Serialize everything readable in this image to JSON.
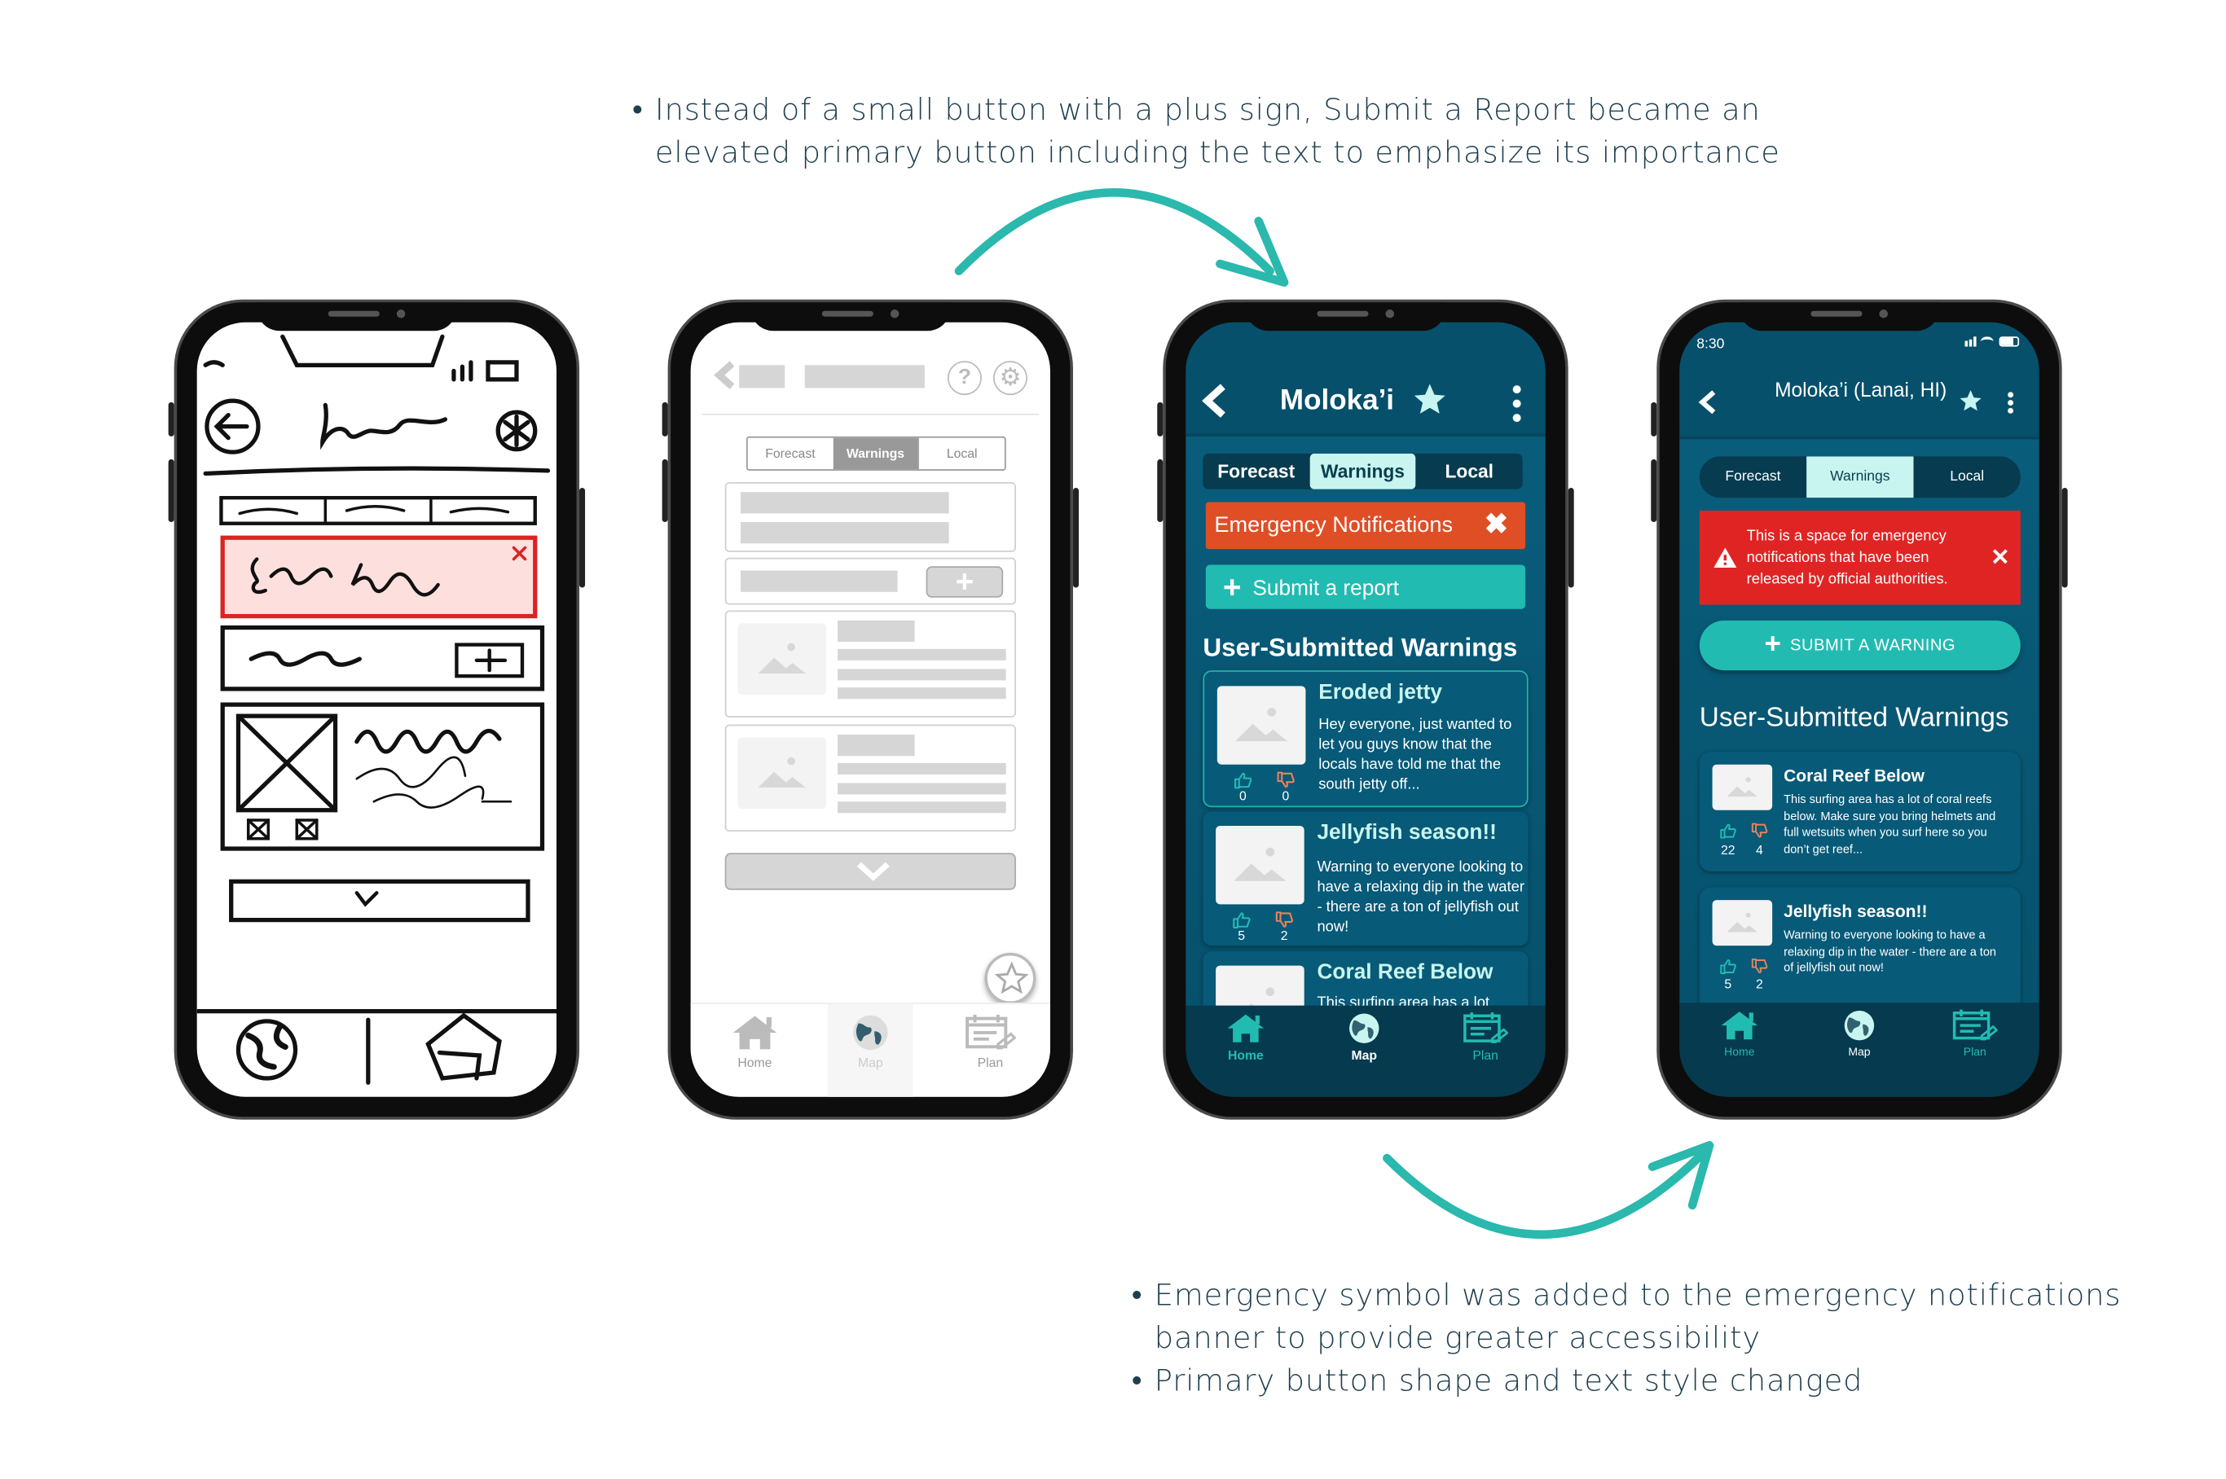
{
  "annotations": {
    "top": [
      "Instead of a small button with a plus sign, Submit a Report became an",
      "elevated primary button including the text to emphasize its importance"
    ],
    "bottom": [
      [
        "Emergency symbol was added to the emergency notifications",
        "banner to provide greater accessibility"
      ],
      [
        "Primary button shape and text style changed"
      ]
    ],
    "bullet": "•",
    "arrow_color": "#2bb8ad"
  },
  "wireframe": {
    "tabs": [
      "Forecast",
      "Warnings",
      "Local"
    ],
    "active_tab": "Warnings",
    "nav": [
      "Home",
      "Map",
      "Plan"
    ],
    "icons": [
      "back-chevron-icon",
      "help-icon",
      "gear-icon",
      "plus-icon",
      "image-placeholder-icon",
      "chevron-down-icon",
      "star-icon"
    ]
  },
  "v1": {
    "title": "Moloka’i",
    "tabs": [
      "Forecast",
      "Warnings",
      "Local"
    ],
    "active_tab": "Warnings",
    "emergency": "Emergency Notifications",
    "submit": "Submit a report",
    "heading": "User-Submitted Warnings",
    "cards": [
      {
        "title": "Eroded jetty",
        "body": "Hey everyone, just wanted to let you guys know that the locals have told me that the south jetty off...",
        "up": "0",
        "down": "0"
      },
      {
        "title": "Jellyfish season!!",
        "body": "Warning to everyone looking to have a relaxing dip in the water - there are a ton of jellyfish out now!",
        "up": "5",
        "down": "2"
      },
      {
        "title": "Coral Reef Below",
        "body": "This surfing area has a lot"
      }
    ],
    "nav": [
      "Home",
      "Map",
      "Plan"
    ],
    "colors": {
      "bg": "#0a5f7d",
      "accent": "#22bbb2",
      "emergency": "#e04e25",
      "active_tab": "#c8f5ef"
    }
  },
  "v2": {
    "time": "8:30",
    "title": "Moloka’i (Lanai, HI)",
    "tabs": [
      "Forecast",
      "Warnings",
      "Local"
    ],
    "active_tab": "Warnings",
    "emergency": "This is a space for emergency notifications that have been released by official authorities.",
    "submit": "SUBMIT A WARNING",
    "heading": "User-Submitted Warnings",
    "cards": [
      {
        "title": "Coral Reef Below",
        "body": "This surfing area has a lot of coral reefs below. Make sure you bring helmets and full wetsuits when you surf here so you don’t get reef...",
        "up": "22",
        "down": "4"
      },
      {
        "title": "Jellyfish season!!",
        "body": "Warning to everyone looking to have a relaxing dip in the water - there are a ton of jellyfish out now!",
        "up": "5",
        "down": "2"
      }
    ],
    "nav": [
      "Home",
      "Map",
      "Plan"
    ],
    "colors": {
      "emergency": "#e02424",
      "accent": "#22bbb2"
    }
  }
}
